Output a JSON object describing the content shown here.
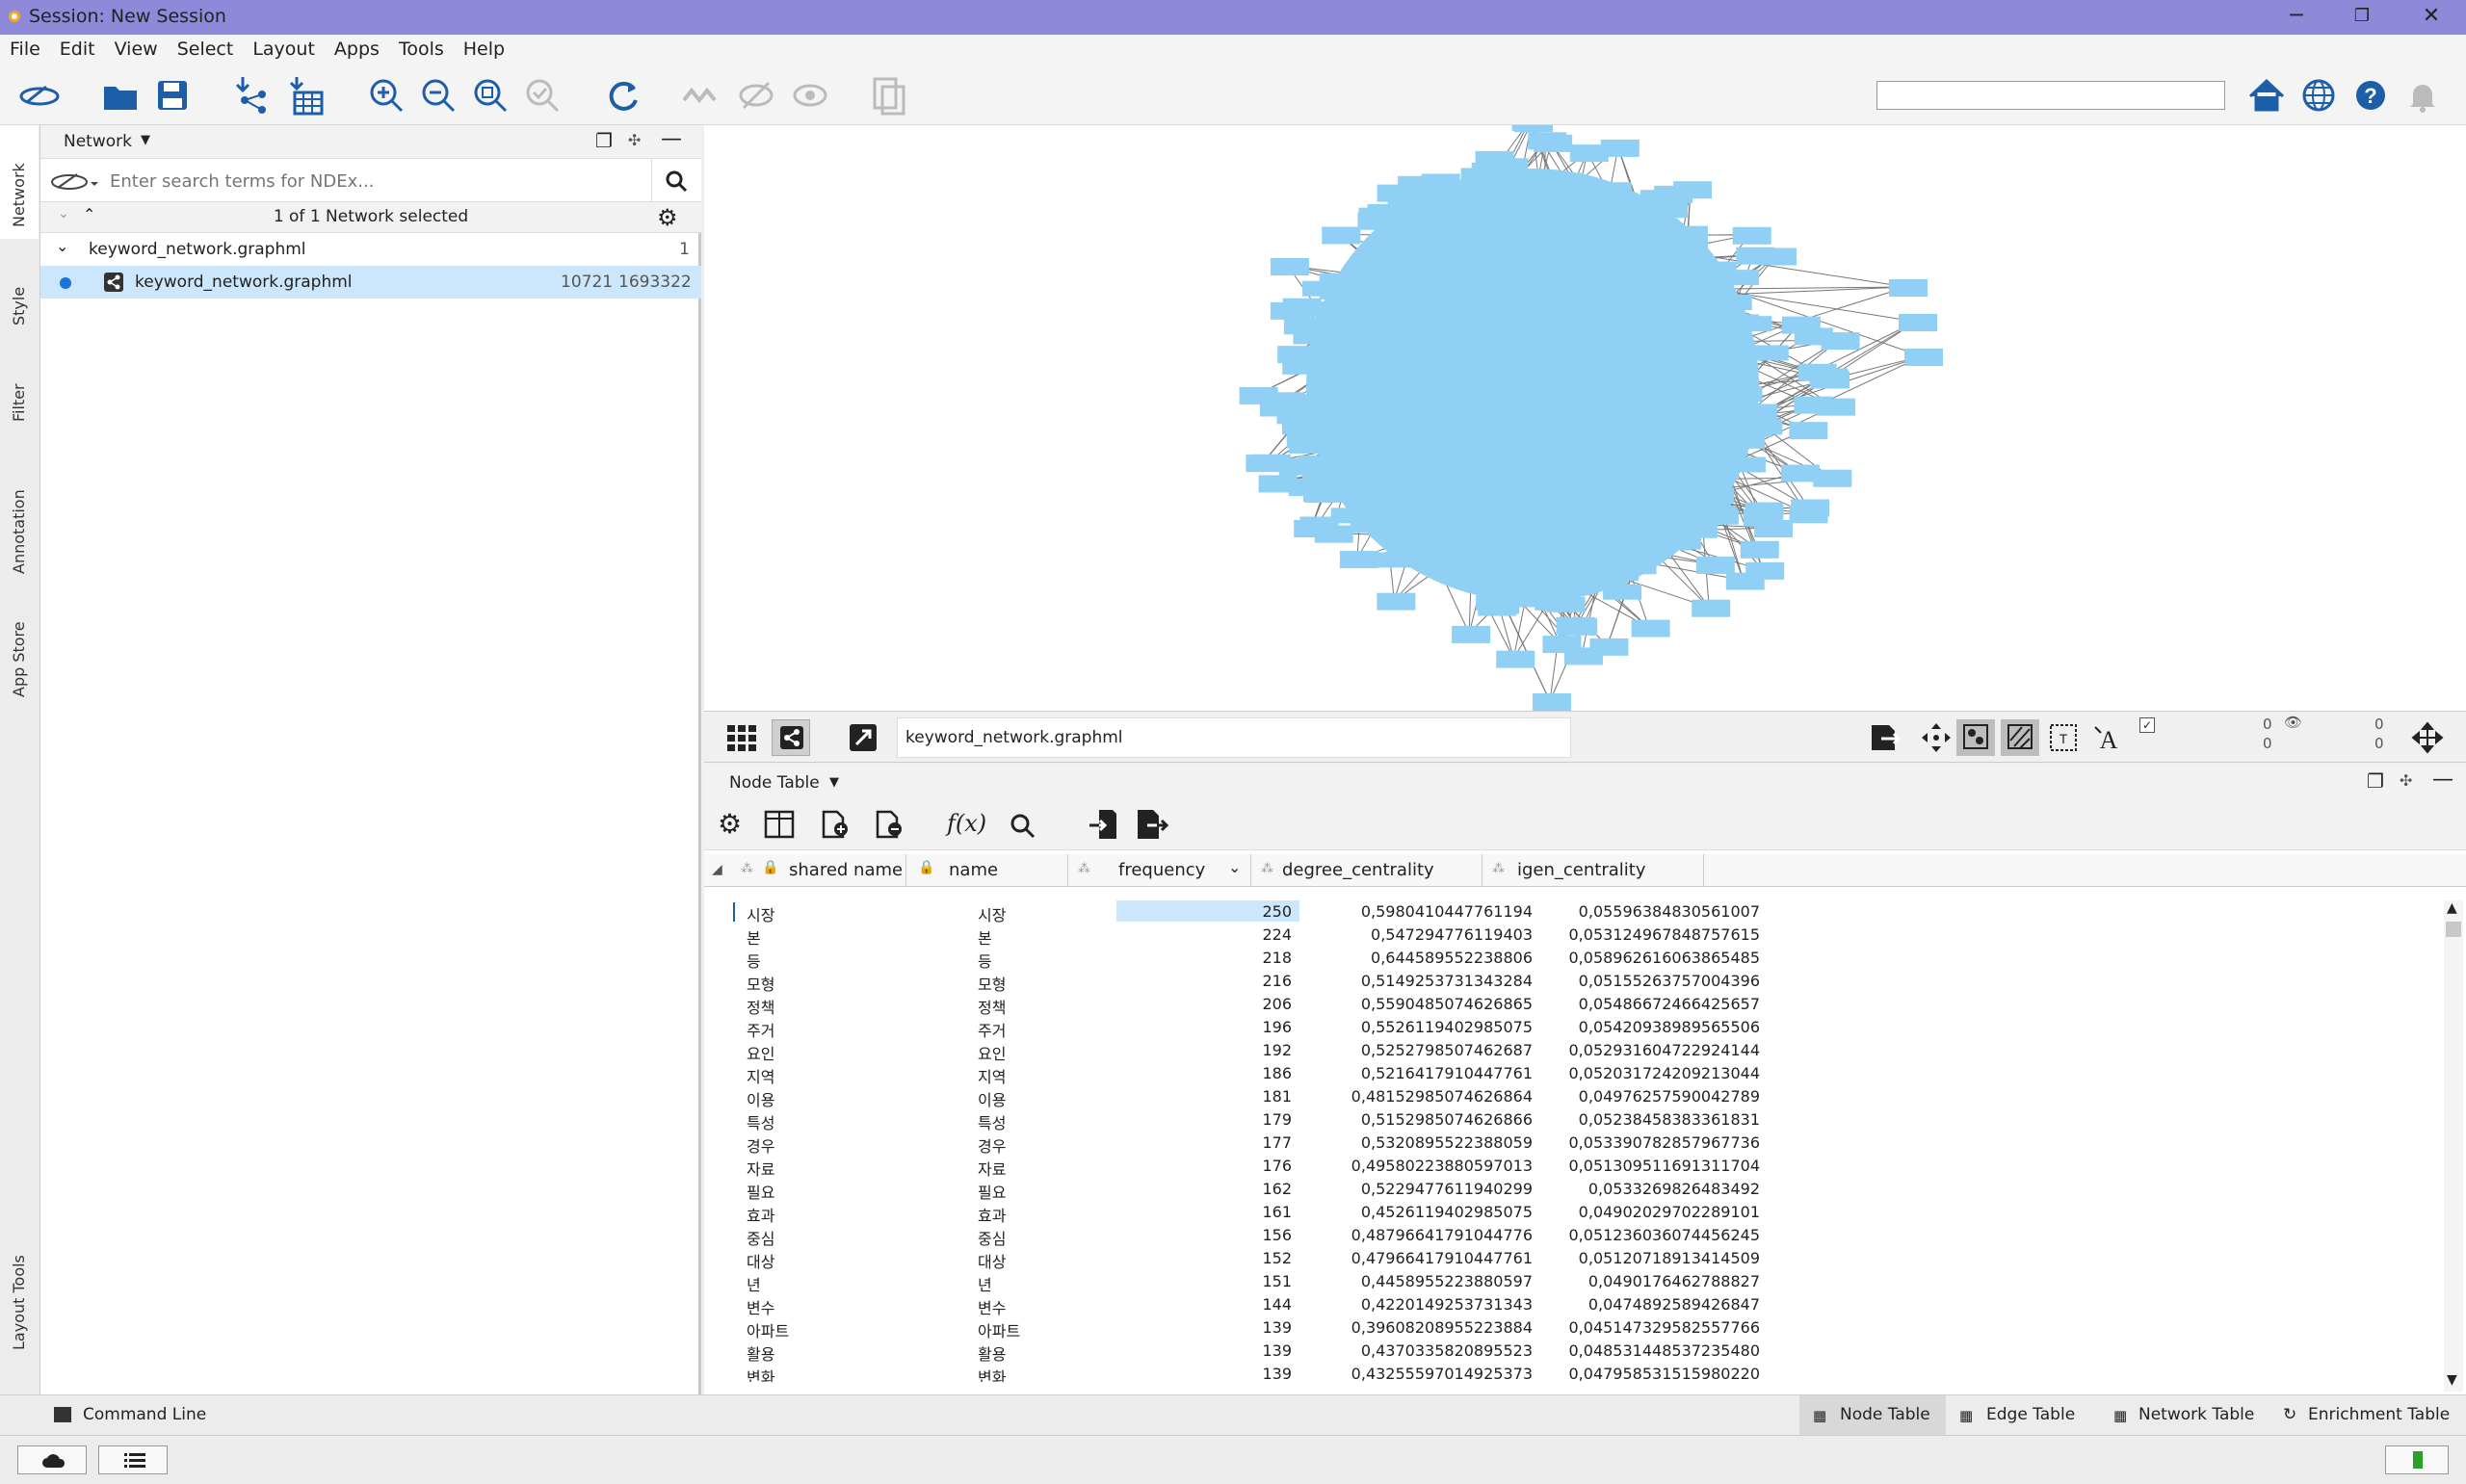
{
  "window": {
    "title": "Session: New Session",
    "minimize": "─",
    "maximize": "❐",
    "close": "✕"
  },
  "menu": [
    "File",
    "Edit",
    "View",
    "Select",
    "Layout",
    "Apps",
    "Tools",
    "Help"
  ],
  "sidebar_tabs": [
    "Network",
    "Style",
    "Filter",
    "Annotation",
    "App Store",
    "Layout Tools"
  ],
  "network_panel": {
    "title": "Network",
    "ndex_placeholder": "Enter search terms for NDEx...",
    "selection": "1 of 1 Network selected",
    "collection": {
      "name": "keyword_network.graphml",
      "count": "1"
    },
    "network": {
      "name": "keyword_network.graphml",
      "nodes": "10721",
      "edges": "1693322"
    }
  },
  "view_bar": {
    "network_name": "keyword_network.graphml",
    "sel_nodes": "0",
    "hidden_nodes": "0",
    "sel_edges": "0",
    "hidden_edges": "0"
  },
  "node_table": {
    "title": "Node Table",
    "fx_label": "f(x)",
    "columns": [
      "shared name",
      "name",
      "frequency",
      "degree_centrality",
      "igen_centrality"
    ],
    "rows": [
      [
        "시장",
        "시장",
        "250",
        "0,5980410447761194",
        "0,05596384830561007"
      ],
      [
        "본",
        "본",
        "224",
        "0,547294776119403",
        "0,053124967848757615"
      ],
      [
        "등",
        "등",
        "218",
        "0,644589552238806",
        "0,058962616063865485"
      ],
      [
        "모형",
        "모형",
        "216",
        "0,5149253731343284",
        "0,05155263757004396"
      ],
      [
        "정책",
        "정책",
        "206",
        "0,5590485074626865",
        "0,05486672466425657"
      ],
      [
        "주거",
        "주거",
        "196",
        "0,5526119402985075",
        "0,05420938989565506"
      ],
      [
        "요인",
        "요인",
        "192",
        "0,5252798507462687",
        "0,052931604722924144"
      ],
      [
        "지역",
        "지역",
        "186",
        "0,5216417910447761",
        "0,052031724209213044"
      ],
      [
        "이용",
        "이용",
        "181",
        "0,48152985074626864",
        "0,04976257590042789"
      ],
      [
        "특성",
        "특성",
        "179",
        "0,5152985074626866",
        "0,05238458383361831"
      ],
      [
        "경우",
        "경우",
        "177",
        "0,5320895522388059",
        "0,053390782857967736"
      ],
      [
        "자료",
        "자료",
        "176",
        "0,49580223880597013",
        "0,051309511691311704"
      ],
      [
        "필요",
        "필요",
        "162",
        "0,5229477611940299",
        "0,0533269826483492"
      ],
      [
        "효과",
        "효과",
        "161",
        "0,4526119402985075",
        "0,04902029702289101"
      ],
      [
        "중심",
        "중심",
        "156",
        "0,48796641791044776",
        "0,051236036074456245"
      ],
      [
        "대상",
        "대상",
        "152",
        "0,47966417910447761",
        "0,05120718913414509"
      ],
      [
        "년",
        "년",
        "151",
        "0,4458955223880597",
        "0,0490176462788827"
      ],
      [
        "변수",
        "변수",
        "144",
        "0,4220149253731343",
        "0,0474892589426847"
      ],
      [
        "아파트",
        "아파트",
        "139",
        "0,39608208955223884",
        "0,045147329582557766"
      ],
      [
        "활용",
        "활용",
        "139",
        "0,4370335820895523",
        "0,048531448537235480"
      ],
      [
        "변화",
        "변화",
        "139",
        "0,43255597014925373",
        "0,047958531515980220"
      ]
    ]
  },
  "bottom_tabs": [
    "Command Line",
    "Node Table",
    "Edge Table",
    "Network Table",
    "Enrichment Table"
  ],
  "colors": {
    "titlebar": "#8e89d9",
    "node": "#8fd0f4",
    "selection": "#cce6fb",
    "icon_blue": "#1d5ea8"
  }
}
